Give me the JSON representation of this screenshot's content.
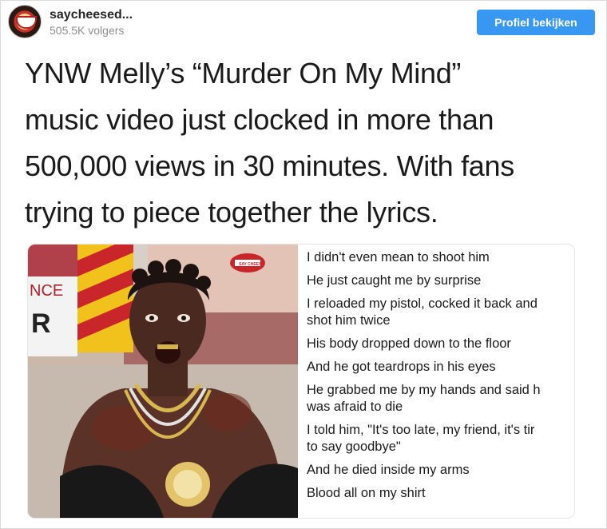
{
  "post": {
    "username": "saycheesed...",
    "followers": "505.5K volgers",
    "profile_button": "Profiel bekijken"
  },
  "headline": {
    "lines": [
      "YNW Melly’s “Murder On My Mind”",
      "music video just clocked in more than",
      "500,000 views in 30 minutes. With fans",
      "trying to piece together the lyrics."
    ]
  },
  "photo": {
    "sign_text_1": "NCE",
    "sign_text_2": "R",
    "logo": "SAY CHEESE"
  },
  "lyrics": [
    [
      "I didn't even mean to shoot him"
    ],
    [
      "He just caught me by surprise"
    ],
    [
      "I reloaded my pistol, cocked it back and",
      "shot him twice"
    ],
    [
      "His body dropped down to the floor"
    ],
    [
      "And he got teardrops in his eyes"
    ],
    [
      "He grabbed me by my hands and said h",
      "was afraid to die"
    ],
    [
      "I told him, \"It's too late, my friend, it's tir",
      "to say goodbye\""
    ],
    [
      "And he died inside my arms"
    ],
    [
      "Blood all on my shirt"
    ]
  ]
}
